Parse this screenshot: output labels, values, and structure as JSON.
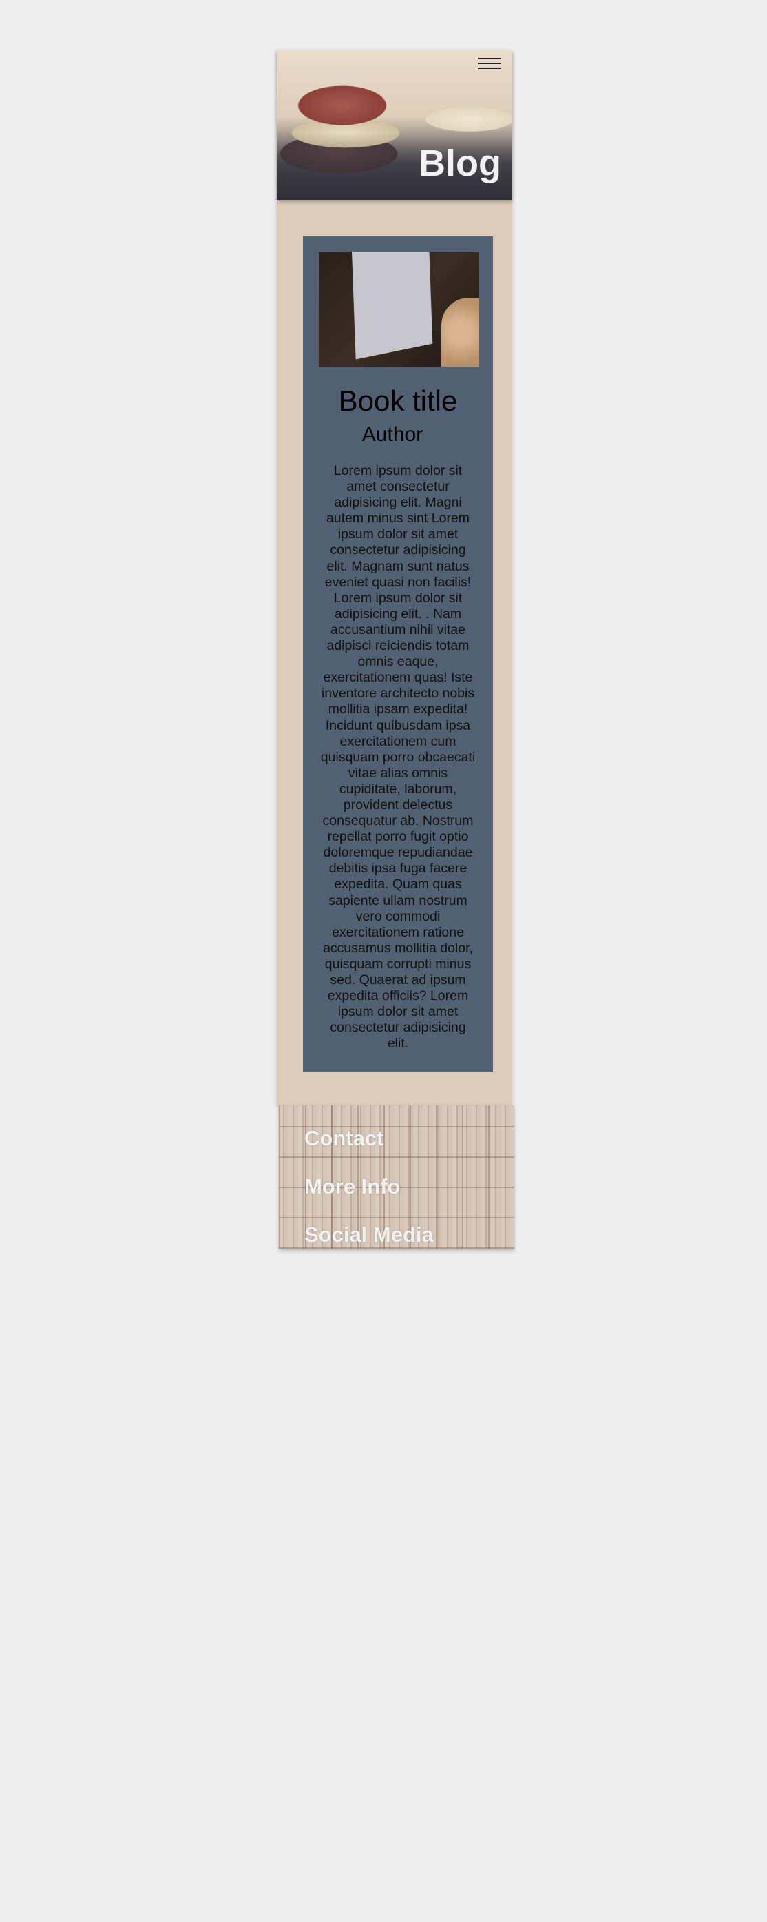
{
  "header": {
    "title": "Blog",
    "menu_icon": "hamburger-menu-icon"
  },
  "card": {
    "image_alt": "The Strength in Our Scars book",
    "book_title": "Book title",
    "author": "Author",
    "description": "Lorem ipsum dolor sit amet consectetur adipisicing elit. Magni autem minus sint Lorem ipsum dolor sit amet consectetur adipisicing elit. Magnam sunt natus eveniet quasi non facilis! Lorem ipsum dolor sit adipisicing elit. . Nam accusantium nihil vitae adipisci reiciendis totam omnis eaque, exercitationem quas! Iste inventore architecto nobis mollitia ipsam expedita! Incidunt quibusdam ipsa exercitationem cum quisquam porro obcaecati vitae alias omnis cupiditate, laborum, provident delectus consequatur ab. Nostrum repellat porro fugit optio doloremque repudiandae debitis ipsa fuga facere expedita. Quam quas sapiente ullam nostrum vero commodi exercitationem ratione accusamus mollitia dolor, quisquam corrupti minus sed. Quaerat ad ipsum expedita officiis? Lorem ipsum dolor sit amet consectetur adipisicing elit."
  },
  "footer": {
    "links": [
      {
        "label": "Contact"
      },
      {
        "label": "More Info"
      },
      {
        "label": "Social Media"
      }
    ]
  },
  "colors": {
    "page_bg": "#eeeeee",
    "container_bg": "#dccbb9",
    "card_bg": "#526074",
    "heading_text": "#f2f2f2"
  }
}
